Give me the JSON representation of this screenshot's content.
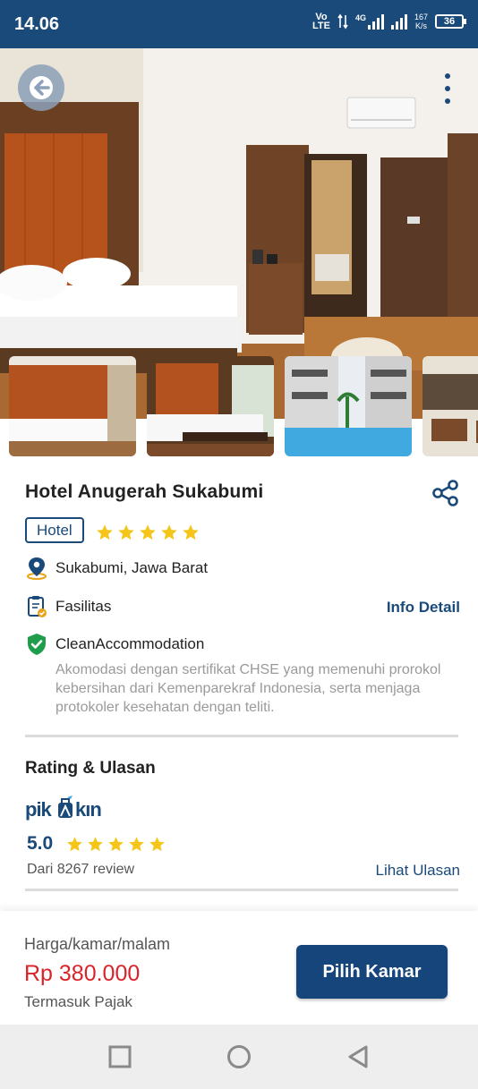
{
  "status_bar": {
    "time": "14.06",
    "volte_top": "Vo",
    "volte_bottom": "LTE",
    "network": "4G",
    "speed_value": "167",
    "speed_unit": "K/s",
    "battery": "36"
  },
  "hero": {
    "back_icon": "arrow-left-icon",
    "more_icon": "more-vertical-icon"
  },
  "hotel": {
    "name": "Hotel Anugerah Sukabumi",
    "type": "Hotel",
    "star_rating": 5,
    "location": "Sukabumi, Jawa Barat",
    "facilities_label": "Fasilitas",
    "info_detail": "Info Detail",
    "clean_title": "CleanAccommodation",
    "clean_desc": "Akomodasi dengan sertifikat CHSE yang memenuhi prorokol kebersihan dari Kemenparekraf Indonesia, serta menjaga protokoler kesehatan dengan teliti."
  },
  "rating": {
    "section_title": "Rating & Ulasan",
    "brand": "pikniku",
    "score": "5.0",
    "stars": 5,
    "review_count": "Dari 8267 review",
    "see_reviews": "Lihat Ulasan"
  },
  "booking": {
    "price_label": "Harga/kamar/malam",
    "price": "Rp 380.000",
    "tax_note": "Termasuk Pajak",
    "cta": "Pilih Kamar"
  },
  "colors": {
    "primary": "#1a4a7a",
    "price_red": "#d9232a",
    "star": "#f5c518",
    "clean_green": "#1e9e4a"
  }
}
